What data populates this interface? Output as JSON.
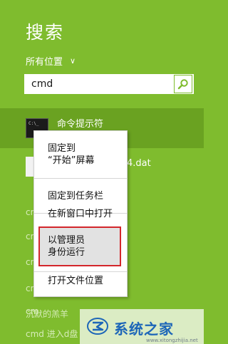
{
  "header": {
    "title": "搜索",
    "scope_label": "所有位置",
    "scope_chevron": "∨"
  },
  "search": {
    "value": "cmd",
    "button_icon": "search-icon"
  },
  "results": {
    "selected": {
      "label": "命令提示符",
      "icon_text": "C:\\_"
    },
    "second": {
      "suffix": "4.dat"
    },
    "faded": [
      {
        "text": "cm"
      },
      {
        "text": "cm"
      },
      {
        "text": "cm"
      },
      {
        "text": "cm"
      },
      {
        "text": "cm"
      },
      {
        "text": "沉默的羔羊"
      },
      {
        "text": "cmd 进入d盘"
      }
    ]
  },
  "context_menu": {
    "items": [
      {
        "line1": "固定到",
        "line2": "“开始”屏幕"
      },
      {
        "line1": "固定到任务栏"
      },
      {
        "line1": "在新窗口中打开"
      },
      {
        "line1": "以管理员",
        "line2": "身份运行"
      },
      {
        "line1": "打开文件位置"
      }
    ],
    "highlight_color": "#d3262b"
  },
  "watermark": {
    "text": "系统之家",
    "url": "www.xitongzhijia.net"
  },
  "colors": {
    "background": "#7fbc2e",
    "selection": "#6aa221"
  }
}
